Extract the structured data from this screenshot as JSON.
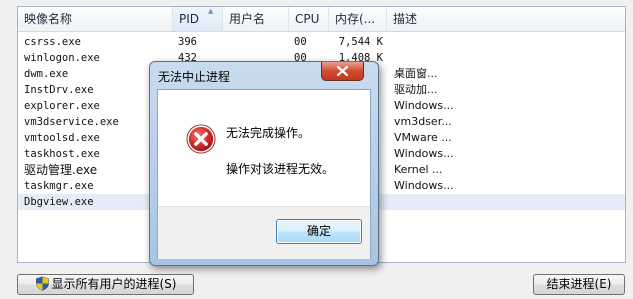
{
  "columns": {
    "name": "映像名称",
    "pid": "PID",
    "user": "用户名",
    "cpu": "CPU",
    "memory": "内存(...",
    "desc": "描述"
  },
  "processes": [
    {
      "name": "csrss.exe",
      "pid": "396",
      "cpu": "00",
      "memory": "7,544 K",
      "desc": ""
    },
    {
      "name": "winlogon.exe",
      "pid": "432",
      "cpu": "00",
      "memory": "1,408 K",
      "desc": ""
    },
    {
      "name": "dwm.exe",
      "pid": "",
      "cpu": "",
      "memory": "",
      "desc": "桌面窗..."
    },
    {
      "name": "InstDrv.exe",
      "pid": "",
      "cpu": "",
      "memory": "",
      "desc": "驱动加..."
    },
    {
      "name": "explorer.exe",
      "pid": "",
      "cpu": "",
      "memory": "",
      "desc": "Windows..."
    },
    {
      "name": "vm3dservice.exe",
      "pid": "",
      "cpu": "",
      "memory": "",
      "desc": "vm3dser..."
    },
    {
      "name": "vmtoolsd.exe",
      "pid": "",
      "cpu": "",
      "memory": "",
      "desc": "VMware ..."
    },
    {
      "name": "taskhost.exe",
      "pid": "",
      "cpu": "",
      "memory": "",
      "desc": "Windows..."
    },
    {
      "name": "驱动管理.exe",
      "pid": "",
      "cpu": "",
      "memory": "",
      "desc": "Kernel ..."
    },
    {
      "name": "taskmgr.exe",
      "pid": "",
      "cpu": "",
      "memory": "",
      "desc": "Windows..."
    },
    {
      "name": "Dbgview.exe",
      "pid": "",
      "cpu": "",
      "memory": "",
      "desc": ""
    }
  ],
  "buttons": {
    "show_all_users": "显示所有用户的进程(S)",
    "end_process": "结束进程(E)"
  },
  "dialog": {
    "title": "无法中止进程",
    "message_line1": "无法完成操作。",
    "message_line2": "操作对该进程无效。",
    "ok_label": "确定"
  },
  "icons": {
    "close": "close-icon",
    "error": "error-icon",
    "shield": "uac-shield-icon"
  },
  "colors": {
    "close_button": "#c7412b",
    "error_icon": "#c8282d",
    "ok_button_border": "#3c7fb1"
  }
}
